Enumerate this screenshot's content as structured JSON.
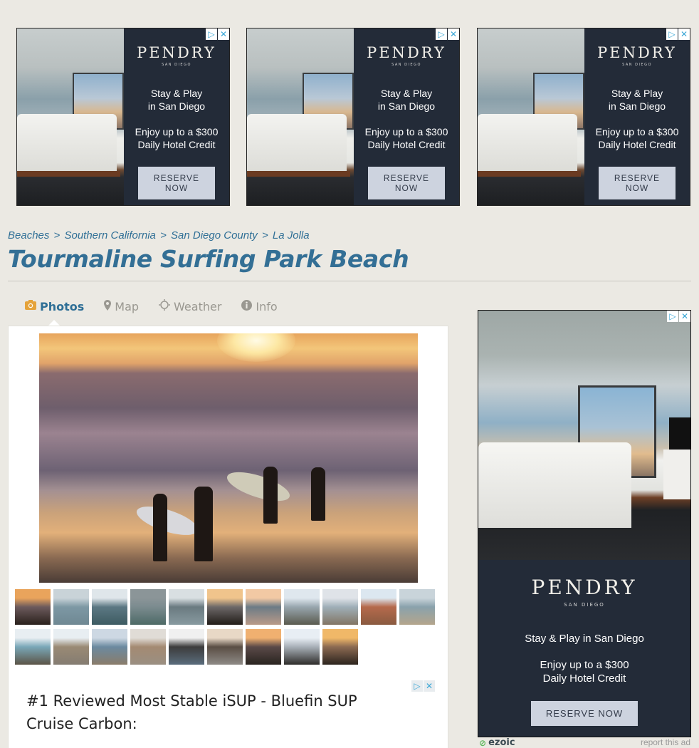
{
  "top_ads": [
    {
      "brand": "PENDRY",
      "brand_sub": "SAN DIEGO",
      "line1": "Stay & Play",
      "line2": "in San Diego",
      "line3": "Enjoy up to a $300",
      "line4": "Daily Hotel Credit",
      "cta": "RESERVE NOW"
    },
    {
      "brand": "PENDRY",
      "brand_sub": "SAN DIEGO",
      "line1": "Stay & Play",
      "line2": "in San Diego",
      "line3": "Enjoy up to a $300",
      "line4": "Daily Hotel Credit",
      "cta": "RESERVE NOW"
    },
    {
      "brand": "PENDRY",
      "brand_sub": "SAN DIEGO",
      "line1": "Stay & Play",
      "line2": "in San Diego",
      "line3": "Enjoy up to a $300",
      "line4": "Daily Hotel Credit",
      "cta": "RESERVE NOW"
    }
  ],
  "adchoices": {
    "info_icon": "▷",
    "close_icon": "✕"
  },
  "breadcrumb": [
    {
      "label": "Beaches"
    },
    {
      "label": "Southern California"
    },
    {
      "label": "San Diego County"
    },
    {
      "label": "La Jolla"
    }
  ],
  "breadcrumb_separator": ">",
  "page_title": "Tourmaline Surfing Park Beach",
  "tabs": [
    {
      "label": "Photos",
      "icon": "camera-icon",
      "glyph": "📷",
      "active": true
    },
    {
      "label": "Map",
      "icon": "map-marker-icon",
      "glyph": "⚲",
      "active": false
    },
    {
      "label": "Weather",
      "icon": "sun-icon",
      "glyph": "☼",
      "active": false
    },
    {
      "label": "Info",
      "icon": "info-icon",
      "glyph": "ℹ",
      "active": false
    }
  ],
  "gallery": {
    "main_photo_alt": "Surfers carrying boards at sunset on the beach",
    "thumbnail_count": 20,
    "thumbnails": [
      {
        "colors": [
          "#e9a45c",
          "#6c5a5c",
          "#2a211c"
        ]
      },
      {
        "colors": [
          "#c9d3d8",
          "#7d98a4",
          "#6f8893"
        ]
      },
      {
        "colors": [
          "#dfe6ea",
          "#5c7883",
          "#3d5b62"
        ]
      },
      {
        "colors": [
          "#8b9598",
          "#7b8b8f",
          "#4d6a66"
        ]
      },
      {
        "colors": [
          "#d9dfe2",
          "#6a7a80",
          "#889aa0"
        ]
      },
      {
        "colors": [
          "#f0c48c",
          "#6c6868",
          "#221c18"
        ]
      },
      {
        "colors": [
          "#f2c9a4",
          "#6c7b86",
          "#b99a88"
        ]
      },
      {
        "colors": [
          "#dfe7ee",
          "#98a6ae",
          "#5a5a4e"
        ]
      },
      {
        "colors": [
          "#dfe3e8",
          "#9fafb8",
          "#827564"
        ]
      },
      {
        "colors": [
          "#dce7f0",
          "#b56a4c",
          "#8a5a40"
        ]
      },
      {
        "colors": [
          "#c9d4da",
          "#8aa2ac",
          "#b4a58c"
        ]
      },
      {
        "colors": [
          "#e8eef2",
          "#7aa7b8",
          "#5b5446"
        ]
      },
      {
        "colors": [
          "#e8eef2",
          "#9a8a74",
          "#847c72"
        ]
      },
      {
        "colors": [
          "#cdd8e3",
          "#6b8aa0",
          "#8a7c6a"
        ]
      },
      {
        "colors": [
          "#e0dcd6",
          "#a48a72",
          "#9a8f82"
        ]
      },
      {
        "colors": [
          "#f0f0f0",
          "#3c3c3c",
          "#5a6c7c"
        ]
      },
      {
        "colors": [
          "#e8d8c6",
          "#5a4e44",
          "#8e8a86"
        ]
      },
      {
        "colors": [
          "#f0b070",
          "#5a4a48",
          "#2a2420"
        ]
      },
      {
        "colors": [
          "#e8eef4",
          "#a8b0b8",
          "#2e2c2a"
        ]
      },
      {
        "colors": [
          "#f0b868",
          "#8c6a52",
          "#2c241e"
        ]
      }
    ]
  },
  "sponsored": {
    "text": "#1 Reviewed Most Stable iSUP - Bluefin SUP Cruise Carbon:"
  },
  "right_ad": {
    "brand": "PENDRY",
    "brand_sub": "SAN DIEGO",
    "line1": "Stay & Play in San Diego",
    "line3": "Enjoy up to a $300",
    "line4": "Daily Hotel Credit",
    "cta": "RESERVE NOW"
  },
  "footer": {
    "ezoic_label": "ezoic",
    "report_label": "report this ad"
  },
  "colors": {
    "background": "#ebe9e3",
    "link": "#2f6f96",
    "title": "#336f95",
    "ad_bg": "#232b38",
    "active_tab_icon": "#e5a33a"
  }
}
